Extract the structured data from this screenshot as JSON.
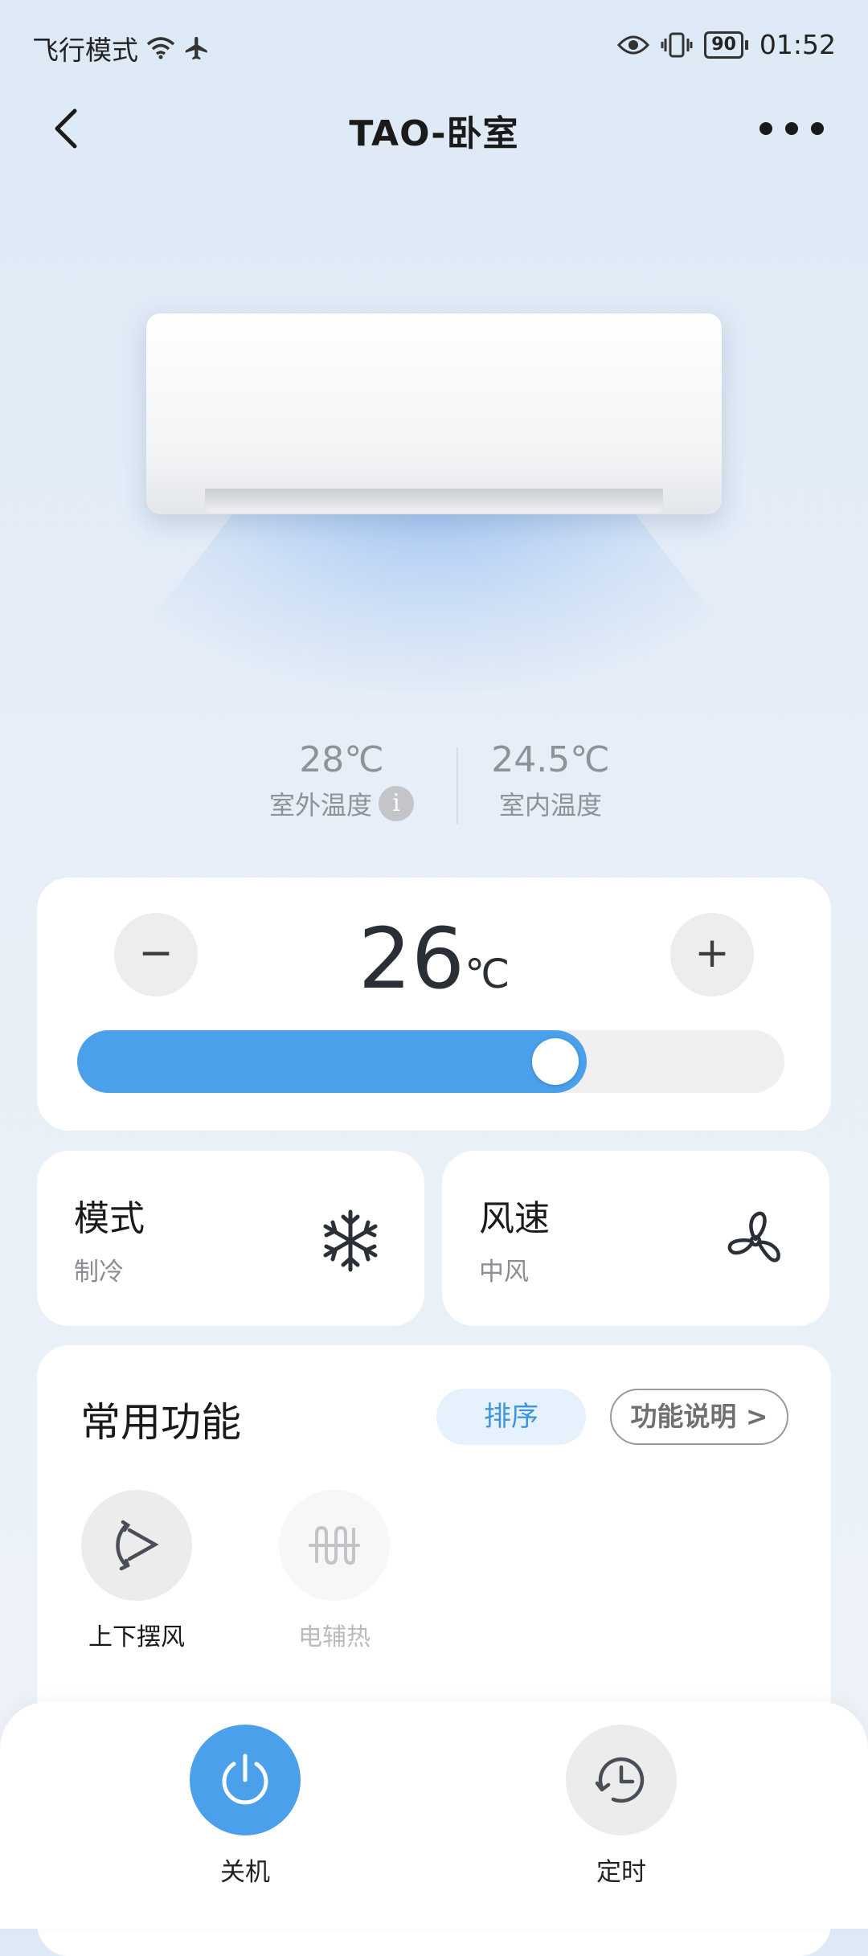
{
  "status_bar": {
    "airplane_mode_text": "飞行模式",
    "battery": "90",
    "time": "01:52",
    "icons": [
      "wifi-icon",
      "airplane-icon",
      "eye-icon",
      "vibrate-icon",
      "battery-icon"
    ]
  },
  "header": {
    "title": "TAO-卧室",
    "icons": [
      "back-icon",
      "more-icon"
    ]
  },
  "temps": {
    "outdoor_value": "28℃",
    "outdoor_label": "室外温度",
    "info_glyph": "i",
    "indoor_value": "24.5℃",
    "indoor_label": "室内温度"
  },
  "set_temp": {
    "minus": "−",
    "value": "26",
    "unit": "℃",
    "plus": "+",
    "slider_fraction": 0.72,
    "accent_color": "#4aa0ea"
  },
  "mode": {
    "title": "模式",
    "value": "制冷",
    "icon": "snowflake-icon"
  },
  "wind": {
    "title": "风速",
    "value": "中风",
    "icon": "fan-icon"
  },
  "functions": {
    "title": "常用功能",
    "sort_label": "排序",
    "explain_label": "功能说明 >",
    "items": [
      {
        "label": "上下摆风",
        "icon": "swing-icon",
        "enabled": true
      },
      {
        "label": "电辅热",
        "icon": "heater-icon",
        "enabled": false
      }
    ]
  },
  "bottom": {
    "power_label": "关机",
    "timer_label": "定时",
    "power_color": "#4aa0ea"
  }
}
